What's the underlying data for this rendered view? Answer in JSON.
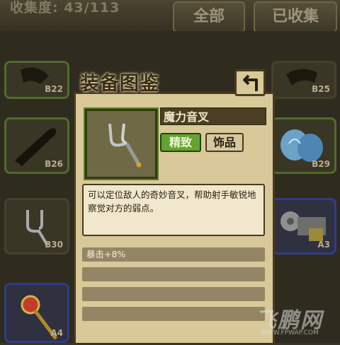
{
  "header": {
    "collection_text": "收集度: 43/113",
    "tabs": [
      {
        "label": "全部"
      },
      {
        "label": "已收集"
      }
    ]
  },
  "grid": {
    "slots": [
      {
        "label": "B22"
      },
      {
        "label": "B25"
      },
      {
        "label": "B26"
      },
      {
        "label": "B29"
      },
      {
        "label": "B30"
      },
      {
        "label": "A3"
      },
      {
        "label": "A4"
      }
    ]
  },
  "modal": {
    "title": "装备图鉴",
    "back_icon": "back-arrow-icon",
    "item_name": "魔力音叉",
    "item_icon": "tuning-fork-icon",
    "quality": "精致",
    "type": "饰品",
    "description": "可以定位敌人的奇妙音叉，帮助射手敏锐地察觉对方的弱点。",
    "stats": [
      "暴击+8%",
      "",
      "",
      ""
    ]
  },
  "watermark": {
    "logo": "飞鹏网",
    "url": "WWW.FPWAP.COM"
  },
  "colors": {
    "quality_green": "#66a232",
    "parchment": "#d9c99a",
    "frame_brown": "#4a3a1e"
  }
}
